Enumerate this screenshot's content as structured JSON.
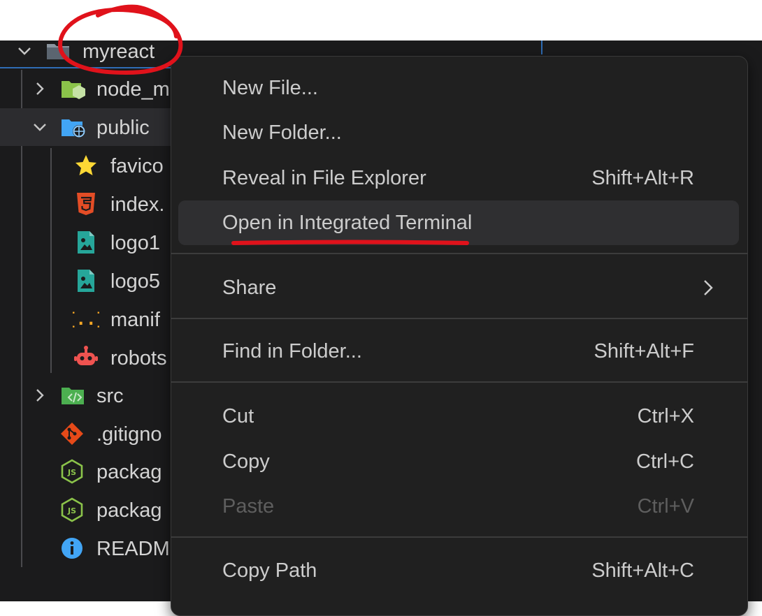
{
  "explorer": {
    "root": {
      "label": "myreact",
      "icon": "folder-icon"
    },
    "items": [
      {
        "label": "node_m",
        "icon": "node-folder-icon",
        "expandable": true
      },
      {
        "label": "public",
        "icon": "public-folder-icon",
        "expandable": true,
        "expanded": true
      },
      {
        "label": "favico",
        "icon": "star-icon"
      },
      {
        "label": "index.",
        "icon": "html-icon"
      },
      {
        "label": "logo1",
        "icon": "image-icon"
      },
      {
        "label": "logo5",
        "icon": "image-icon"
      },
      {
        "label": "manif",
        "icon": "json-icon"
      },
      {
        "label": "robots",
        "icon": "robot-icon"
      },
      {
        "label": "src",
        "icon": "src-folder-icon",
        "expandable": true
      },
      {
        "label": ".gitigno",
        "icon": "git-icon"
      },
      {
        "label": "packag",
        "icon": "nodejs-icon"
      },
      {
        "label": "packag",
        "icon": "nodejs-icon"
      },
      {
        "label": "READM",
        "icon": "info-icon"
      }
    ]
  },
  "context_menu": {
    "items": [
      {
        "label": "New File...",
        "shortcut": ""
      },
      {
        "label": "New Folder...",
        "shortcut": ""
      },
      {
        "label": "Reveal in File Explorer",
        "shortcut": "Shift+Alt+R"
      },
      {
        "label": "Open in Integrated Terminal",
        "shortcut": ""
      },
      {
        "label": "Share",
        "shortcut": ""
      },
      {
        "label": "Find in Folder...",
        "shortcut": "Shift+Alt+F"
      },
      {
        "label": "Cut",
        "shortcut": "Ctrl+X"
      },
      {
        "label": "Copy",
        "shortcut": "Ctrl+C"
      },
      {
        "label": "Paste",
        "shortcut": "Ctrl+V"
      },
      {
        "label": "Copy Path",
        "shortcut": "Shift+Alt+C"
      }
    ]
  },
  "colors": {
    "background": "#1b1b1c",
    "menu_background": "#202020",
    "annotation_red": "#e0121b",
    "text": "#cccccc",
    "disabled_text": "#5e5e5e"
  }
}
